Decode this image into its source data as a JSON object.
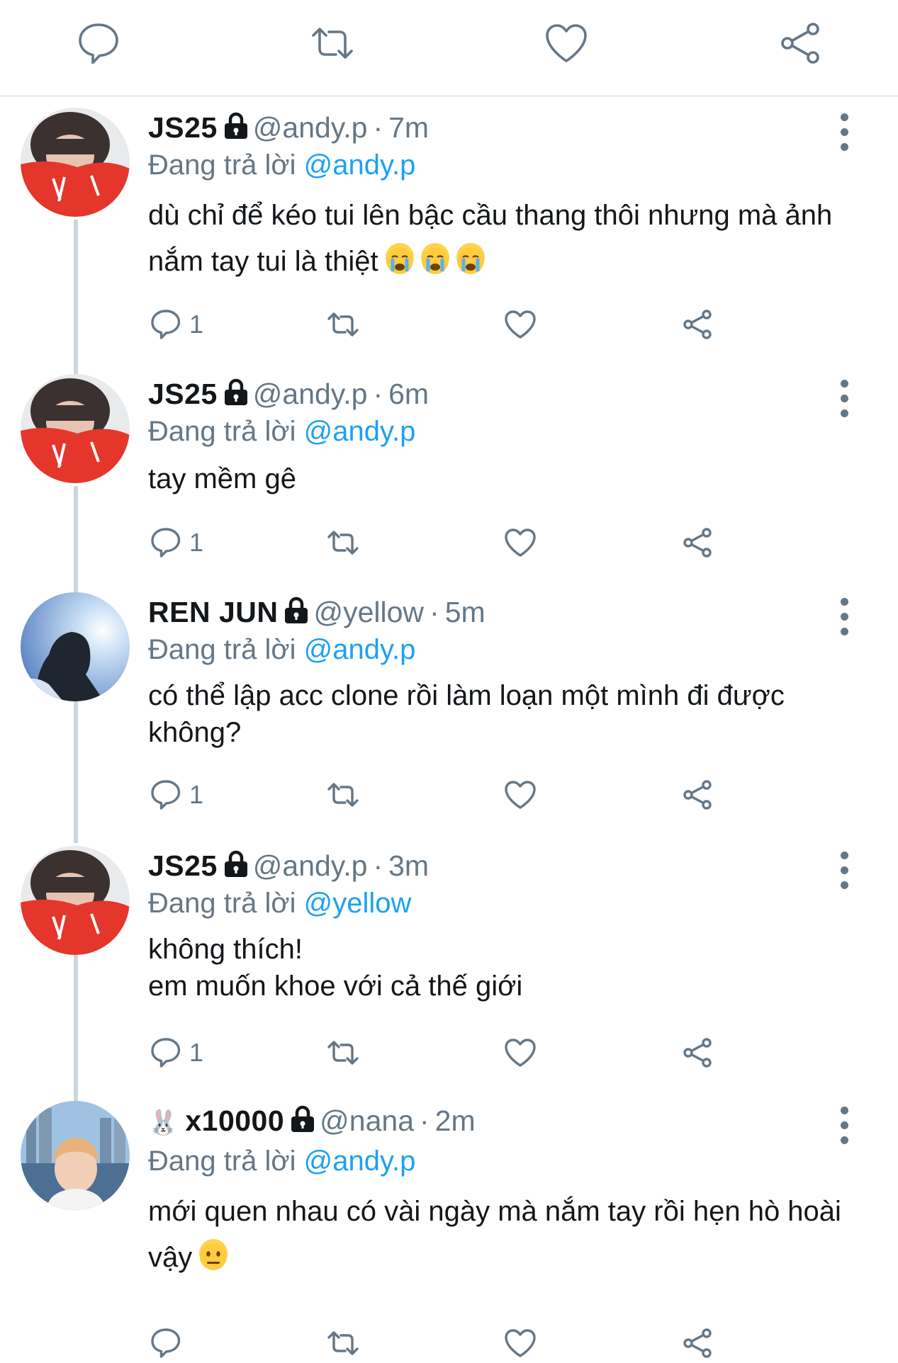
{
  "top_actions": [
    "reply-icon",
    "retweet-icon",
    "like-icon",
    "share-icon"
  ],
  "colors": {
    "accent": "#1da1f2",
    "muted": "#657786",
    "text": "#14171a",
    "divider": "#e6ecf0"
  },
  "tweets": [
    {
      "name": "JS25",
      "name_prefix": "",
      "handle": "@andy.p",
      "time": "7m",
      "replying_label": "Đang trả lời",
      "replying_to": "@andy.p",
      "text": "dù chỉ để kéo tui lên bậc cầu thang thôi nhưng mà ảnh nắm tay tui là thiệt",
      "emoji": [
        "loudly-crying-face",
        "loudly-crying-face",
        "loudly-crying-face"
      ],
      "reply_count": "1",
      "avatar": "red-mask-person"
    },
    {
      "name": "JS25",
      "name_prefix": "",
      "handle": "@andy.p",
      "time": "6m",
      "replying_label": "Đang trả lời",
      "replying_to": "@andy.p",
      "text": "tay mềm gê",
      "emoji": [],
      "reply_count": "1",
      "avatar": "red-mask-person"
    },
    {
      "name": "REN JUN",
      "name_prefix": "",
      "handle": "@yellow",
      "time": "5m",
      "replying_label": "Đang trả lời",
      "replying_to": "@andy.p",
      "text": "có thể lập acc clone rồi làm loạn một mình đi được không?",
      "emoji": [],
      "reply_count": "1",
      "avatar": "sky-silhouette"
    },
    {
      "name": "JS25",
      "name_prefix": "",
      "handle": "@andy.p",
      "time": "3m",
      "replying_label": "Đang trả lời",
      "replying_to": "@yellow",
      "text": "không thích!\nem muốn khoe với cả thế giới",
      "emoji": [],
      "reply_count": "1",
      "avatar": "red-mask-person"
    },
    {
      "name": "x10000",
      "name_prefix": "🐰",
      "handle": "@nana",
      "time": "2m",
      "replying_label": "Đang trả lời",
      "replying_to": "@andy.p",
      "text": "mới quen nhau có vài ngày mà nắm tay rồi hẹn hò hoài vậy",
      "emoji": [
        "neutral-face"
      ],
      "reply_count": "",
      "avatar": "city-portrait"
    }
  ]
}
